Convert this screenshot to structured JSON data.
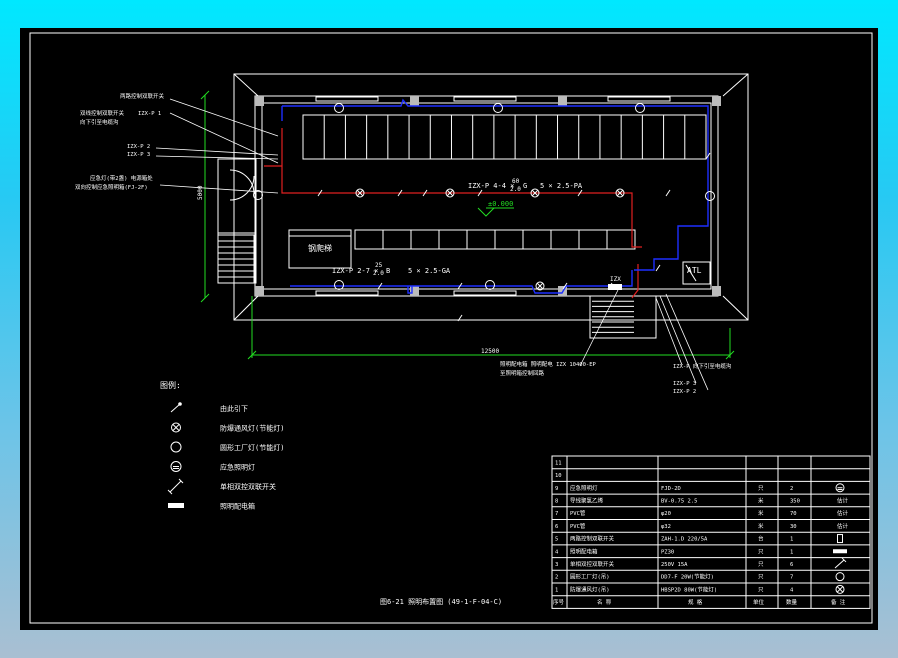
{
  "colors": {
    "background": "#000000",
    "frame": "#ffffff",
    "wire_red": "#e02020",
    "wire_blue": "#1d2fff",
    "dim_green": "#22dd22",
    "elev_green": "#22dd22"
  },
  "plan": {
    "callouts_left": [
      "两路控制双联开关",
      "双线控制双联开关",
      "IZX-P 1",
      "向下引至电缆沟",
      "IZX-P 2",
      "IZX-P 3",
      "应急灯(带2盏) 电源箱处",
      "双向控制应急照明箱(FJ-2F)"
    ],
    "room_label": "钢爬梯",
    "circuit_main": "IZX-P 4-4 × ",
    "circuit_main_frac_num": "60",
    "circuit_main_frac_den": "2.0",
    "circuit_main_suffix": "G",
    "circuit_main_cable": "5 × 2.5-PA",
    "circuit_lower": "IZX-P 2-7 × ",
    "circuit_lower_frac_num": "25",
    "circuit_lower_frac_den": "2.0",
    "circuit_lower_suffix": "B",
    "circuit_lower_cable": "5 × 2.5-GA",
    "elevation": "±0.000",
    "box_label": "IZX",
    "panel_label": "ATL",
    "dim_bottom": "12500",
    "dim_left": "5000",
    "callout_bottom": [
      "照明配电箱 照明配电 IZX 10400-EP",
      "至照明箱控制回路"
    ],
    "callout_right": [
      "IZX-P 向下引至电缆沟",
      "IZX-P 3",
      "IZX-P 2"
    ]
  },
  "legend": {
    "title": "图例:",
    "items": [
      {
        "icon": "down-arrow-icon",
        "label": "由此引下"
      },
      {
        "icon": "ceiling-lamp-icon",
        "label": "防爆通风灯(节能灯)"
      },
      {
        "icon": "circle-lamp-icon",
        "label": "圆形工厂灯(节能灯)"
      },
      {
        "icon": "emergency-lamp-icon",
        "label": "应急照明灯"
      },
      {
        "icon": "switch-icon",
        "label": "单相双控双联开关"
      },
      {
        "icon": "panel-icon",
        "label": "照明配电箱"
      }
    ]
  },
  "caption": "图6-21  照明布置图  (49-1-F-04-C)",
  "table": {
    "headers": [
      "序号",
      "名 称",
      "规 格",
      "单位",
      "数量",
      "备 注"
    ],
    "rows": [
      {
        "no": "11",
        "name": "",
        "spec": "",
        "unit": "",
        "qty": "",
        "note": ""
      },
      {
        "no": "10",
        "name": "",
        "spec": "",
        "unit": "",
        "qty": "",
        "note": ""
      },
      {
        "no": "9",
        "name": "应急照明灯",
        "spec": "FJD-2D",
        "unit": "只",
        "qty": "2",
        "note": "emergency-lamp-icon"
      },
      {
        "no": "8",
        "name": "导线聚氯乙烯",
        "spec": "BV-0.75 2.5",
        "unit": "米",
        "qty": "350",
        "note": "估计"
      },
      {
        "no": "7",
        "name": "PVC管",
        "spec": "φ20",
        "unit": "米",
        "qty": "70",
        "note": "估计"
      },
      {
        "no": "6",
        "name": "PVC管",
        "spec": "φ32",
        "unit": "米",
        "qty": "30",
        "note": "估计"
      },
      {
        "no": "5",
        "name": "两路控制双联开关",
        "spec": "ZAH-1.D 220/5A",
        "unit": "台",
        "qty": "1",
        "note": "panel-outline-icon"
      },
      {
        "no": "4",
        "name": "照明配电箱",
        "spec": "PZ30",
        "unit": "只",
        "qty": "1",
        "note": "panel-icon"
      },
      {
        "no": "3",
        "name": "单相双控双联开关",
        "spec": "250V 15A",
        "unit": "只",
        "qty": "6",
        "note": "switch-icon"
      },
      {
        "no": "2",
        "name": "圆形工厂灯(吊)",
        "spec": "DD7-F 20W(节能灯)",
        "unit": "只",
        "qty": "7",
        "note": "circle-lamp-icon"
      },
      {
        "no": "1",
        "name": "防爆通风灯(吊)",
        "spec": "HBSP2D 80W(节能灯)",
        "unit": "只",
        "qty": "4",
        "note": "ceiling-lamp-icon"
      }
    ]
  }
}
